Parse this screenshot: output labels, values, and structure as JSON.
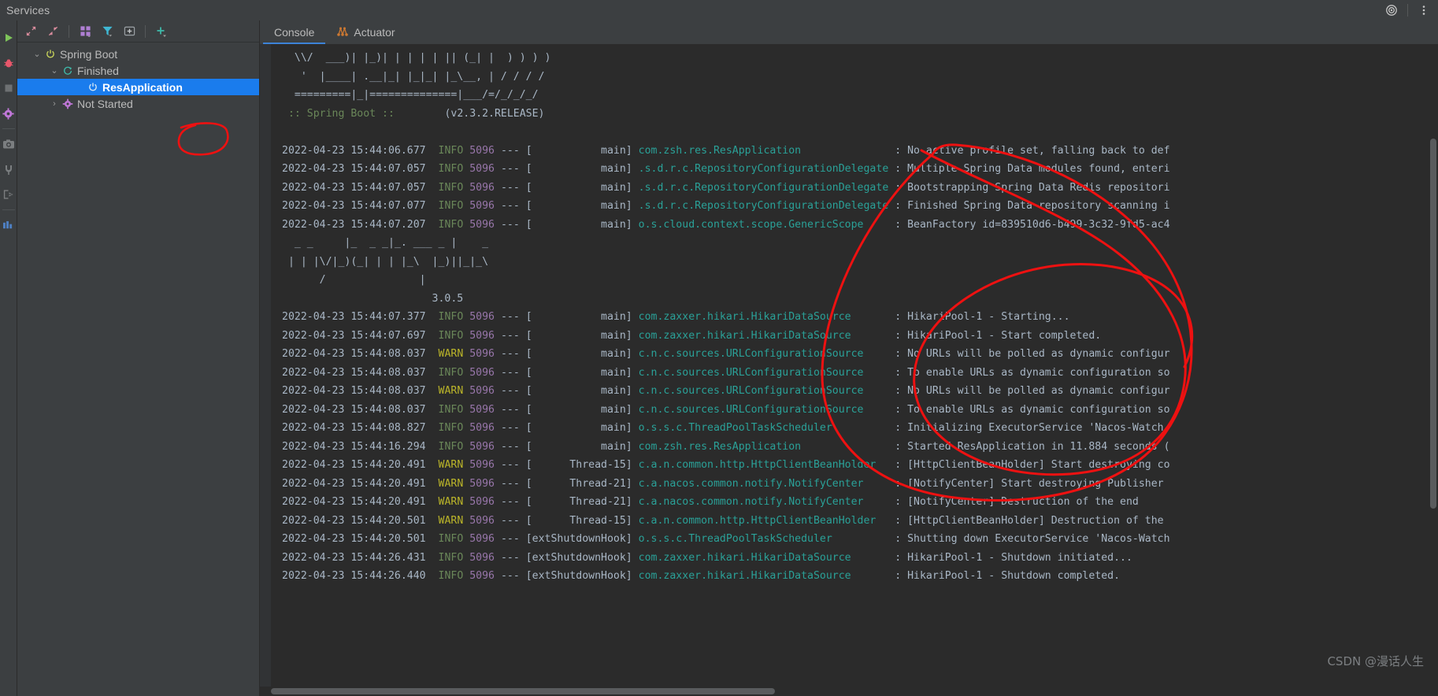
{
  "window": {
    "title": "Services",
    "right_icons": [
      {
        "name": "settings-target-icon",
        "glyph": "◎"
      },
      {
        "name": "more-options-icon",
        "glyph": "⋮"
      }
    ]
  },
  "vertical_strip": {
    "items": [
      {
        "name": "run-icon",
        "label": "Run"
      },
      {
        "name": "debug-icon",
        "label": "Debug"
      },
      {
        "name": "stop-icon",
        "label": "Stop"
      },
      {
        "name": "settings-gear-icon",
        "label": "Settings"
      },
      {
        "name": "camera-icon",
        "label": "Screenshot"
      },
      {
        "name": "plug-icon",
        "label": "Attach"
      },
      {
        "name": "exit-icon",
        "label": "Exit"
      },
      {
        "name": "dashboard-icon",
        "label": "Dashboard"
      }
    ]
  },
  "services_toolbar": {
    "items": [
      {
        "name": "expand-all-icon",
        "label": "Expand All"
      },
      {
        "name": "collapse-all-icon",
        "label": "Collapse All"
      },
      {
        "name": "group-by-icon",
        "label": "Group By"
      },
      {
        "name": "filter-icon",
        "label": "Filter"
      },
      {
        "name": "add-tab-icon",
        "label": "Add Tab"
      },
      {
        "name": "add-service-icon",
        "label": "Add Service"
      }
    ]
  },
  "services_tree": {
    "nodes": [
      {
        "label": "Spring Boot",
        "icon": "spring-boot-power-icon",
        "twist": "⌄",
        "indent": 18,
        "selected": false
      },
      {
        "label": "Finished",
        "icon": "refresh-icon",
        "twist": "⌄",
        "indent": 40,
        "selected": false
      },
      {
        "label": "ResApplication",
        "icon": "power-icon",
        "twist": "",
        "indent": 86,
        "selected": true
      },
      {
        "label": "Not Started",
        "icon": "gear-icon",
        "twist": "›",
        "indent": 40,
        "selected": false
      }
    ]
  },
  "console": {
    "tabs": [
      {
        "label": "Console",
        "icon": "",
        "active": true
      },
      {
        "label": "Actuator",
        "icon": "actuator-icon",
        "active": false
      }
    ],
    "banner_lines": [
      "  \\\\/  ___)| |_)| | | | | || (_| |  ) ) ) )",
      "   '  |____| .__|_| |_|_| |_\\__, | / / / /",
      "  =========|_|==============|___/=/_/_/_/"
    ],
    "spring_boot_line": {
      "label": ":: Spring Boot ::",
      "version": "(v2.3.2.RELEASE)"
    },
    "second_banner_lines": [
      "  _ _     |_  _ _|_. ___ _ |    _ ",
      " | | |\\/|_)(_| | | |_\\  |_)||_|_\\",
      "      /               |           ",
      "                        3.0.5"
    ],
    "log_lines": [
      {
        "date": "2022-04-23 15:44:06.677",
        "level": "INFO",
        "pid": "5096",
        "thread": "main",
        "logger": "com.zsh.res.ResApplication",
        "message": "No active profile set, falling back to def"
      },
      {
        "date": "2022-04-23 15:44:07.057",
        "level": "INFO",
        "pid": "5096",
        "thread": "main",
        "logger": ".s.d.r.c.RepositoryConfigurationDelegate",
        "message": "Multiple Spring Data modules found, enteri"
      },
      {
        "date": "2022-04-23 15:44:07.057",
        "level": "INFO",
        "pid": "5096",
        "thread": "main",
        "logger": ".s.d.r.c.RepositoryConfigurationDelegate",
        "message": "Bootstrapping Spring Data Redis repositori"
      },
      {
        "date": "2022-04-23 15:44:07.077",
        "level": "INFO",
        "pid": "5096",
        "thread": "main",
        "logger": ".s.d.r.c.RepositoryConfigurationDelegate",
        "message": "Finished Spring Data repository scanning i"
      },
      {
        "date": "2022-04-23 15:44:07.207",
        "level": "INFO",
        "pid": "5096",
        "thread": "main",
        "logger": "o.s.cloud.context.scope.GenericScope",
        "message": "BeanFactory id=839510d6-b499-3c32-9fd5-ac4"
      }
    ],
    "log_lines2": [
      {
        "date": "2022-04-23 15:44:07.377",
        "level": "INFO",
        "pid": "5096",
        "thread": "main",
        "logger": "com.zaxxer.hikari.HikariDataSource",
        "message": "HikariPool-1 - Starting..."
      },
      {
        "date": "2022-04-23 15:44:07.697",
        "level": "INFO",
        "pid": "5096",
        "thread": "main",
        "logger": "com.zaxxer.hikari.HikariDataSource",
        "message": "HikariPool-1 - Start completed."
      },
      {
        "date": "2022-04-23 15:44:08.037",
        "level": "WARN",
        "pid": "5096",
        "thread": "main",
        "logger": "c.n.c.sources.URLConfigurationSource",
        "message": "No URLs will be polled as dynamic configur"
      },
      {
        "date": "2022-04-23 15:44:08.037",
        "level": "INFO",
        "pid": "5096",
        "thread": "main",
        "logger": "c.n.c.sources.URLConfigurationSource",
        "message": "To enable URLs as dynamic configuration so"
      },
      {
        "date": "2022-04-23 15:44:08.037",
        "level": "WARN",
        "pid": "5096",
        "thread": "main",
        "logger": "c.n.c.sources.URLConfigurationSource",
        "message": "No URLs will be polled as dynamic configur"
      },
      {
        "date": "2022-04-23 15:44:08.037",
        "level": "INFO",
        "pid": "5096",
        "thread": "main",
        "logger": "c.n.c.sources.URLConfigurationSource",
        "message": "To enable URLs as dynamic configuration so"
      },
      {
        "date": "2022-04-23 15:44:08.827",
        "level": "INFO",
        "pid": "5096",
        "thread": "main",
        "logger": "o.s.s.c.ThreadPoolTaskScheduler",
        "message": "Initializing ExecutorService 'Nacos-Watch-"
      },
      {
        "date": "2022-04-23 15:44:16.294",
        "level": "INFO",
        "pid": "5096",
        "thread": "main",
        "logger": "com.zsh.res.ResApplication",
        "message": "Started ResApplication in 11.884 seconds ("
      },
      {
        "date": "2022-04-23 15:44:20.491",
        "level": "WARN",
        "pid": "5096",
        "thread": "Thread-15",
        "logger": "c.a.n.common.http.HttpClientBeanHolder",
        "message": "[HttpClientBeanHolder] Start destroying co"
      },
      {
        "date": "2022-04-23 15:44:20.491",
        "level": "WARN",
        "pid": "5096",
        "thread": "Thread-21",
        "logger": "c.a.nacos.common.notify.NotifyCenter",
        "message": "[NotifyCenter] Start destroying Publisher"
      },
      {
        "date": "2022-04-23 15:44:20.491",
        "level": "WARN",
        "pid": "5096",
        "thread": "Thread-21",
        "logger": "c.a.nacos.common.notify.NotifyCenter",
        "message": "[NotifyCenter] Destruction of the end"
      },
      {
        "date": "2022-04-23 15:44:20.501",
        "level": "WARN",
        "pid": "5096",
        "thread": "Thread-15",
        "logger": "c.a.n.common.http.HttpClientBeanHolder",
        "message": "[HttpClientBeanHolder] Destruction of the"
      },
      {
        "date": "2022-04-23 15:44:20.501",
        "level": "INFO",
        "pid": "5096",
        "thread": "extShutdownHook",
        "logger": "o.s.s.c.ThreadPoolTaskScheduler",
        "message": "Shutting down ExecutorService 'Nacos-Watch"
      },
      {
        "date": "2022-04-23 15:44:26.431",
        "level": "INFO",
        "pid": "5096",
        "thread": "extShutdownHook",
        "logger": "com.zaxxer.hikari.HikariDataSource",
        "message": "HikariPool-1 - Shutdown initiated..."
      },
      {
        "date": "2022-04-23 15:44:26.440",
        "level": "INFO",
        "pid": "5096",
        "thread": "extShutdownHook",
        "logger": "com.zaxxer.hikari.HikariDataSource",
        "message": "HikariPool-1 - Shutdown completed."
      }
    ]
  },
  "annotations": {
    "color": "#ee1111",
    "shapes": [
      "ellipse-around-resapplication-row",
      "large-ellipse-over-log-messages"
    ]
  },
  "watermark": {
    "text": "CSDN @漫话人生"
  },
  "colors": {
    "panel_bg": "#3c3f41",
    "console_bg": "#2b2b2b",
    "selection": "#1a7ced",
    "info": "#6a8759",
    "warn": "#bbb529",
    "pid": "#9876aa",
    "logger": "#2aa198",
    "text": "#a9b7c6",
    "accent": "#3d83d8",
    "annotation_red": "#ee1111"
  }
}
